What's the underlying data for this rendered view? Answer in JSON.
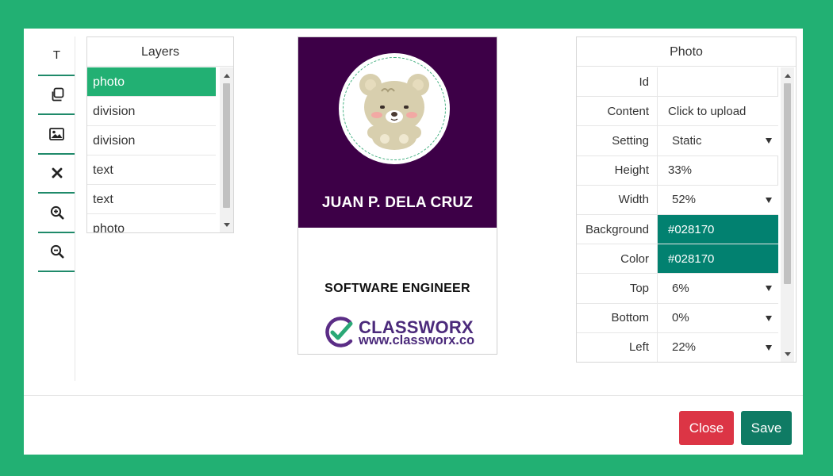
{
  "tools": [
    {
      "name": "text-tool",
      "icon": "text-icon",
      "glyph": "T"
    },
    {
      "name": "duplicate-tool",
      "icon": "copy-icon"
    },
    {
      "name": "image-tool",
      "icon": "image-icon"
    },
    {
      "name": "delete-tool",
      "icon": "close-icon",
      "glyph": "✕"
    },
    {
      "name": "zoom-in-tool",
      "icon": "zoom-in-icon"
    },
    {
      "name": "zoom-out-tool",
      "icon": "zoom-out-icon"
    }
  ],
  "layers": {
    "title": "Layers",
    "items": [
      {
        "label": "photo",
        "active": true
      },
      {
        "label": "division"
      },
      {
        "label": "division"
      },
      {
        "label": "text"
      },
      {
        "label": "text"
      },
      {
        "label": "photo"
      }
    ]
  },
  "card": {
    "name": "JUAN P. DELA CRUZ",
    "title": "SOFTWARE ENGINEER",
    "logo_name": "CLASSWORX",
    "logo_url": "www.classworx.co",
    "colors": {
      "top_bg": "#3d0047",
      "logo": "#4b2a7b",
      "check": "#2aa876"
    }
  },
  "properties": {
    "title": "Photo",
    "rows": [
      {
        "label": "Id",
        "value": "",
        "type": "input"
      },
      {
        "label": "Content",
        "value": "Click to upload",
        "type": "text"
      },
      {
        "label": "Setting",
        "value": "Static",
        "type": "select"
      },
      {
        "label": "Height",
        "value": "33%",
        "type": "input"
      },
      {
        "label": "Width",
        "value": "52%",
        "type": "select"
      },
      {
        "label": "Background",
        "value": "#028170",
        "type": "swatch",
        "color": "#028170"
      },
      {
        "label": "Color",
        "value": "#028170",
        "type": "swatch",
        "color": "#028170"
      },
      {
        "label": "Top",
        "value": "6%",
        "type": "select"
      },
      {
        "label": "Bottom",
        "value": "0%",
        "type": "select"
      },
      {
        "label": "Left",
        "value": "22%",
        "type": "select"
      }
    ]
  },
  "buttons": {
    "close_label": "Close",
    "save_label": "Save"
  },
  "colors": {
    "page_bg": "#22b073",
    "accent": "#22b073",
    "close": "#dc3545",
    "save": "#0f7b64"
  }
}
